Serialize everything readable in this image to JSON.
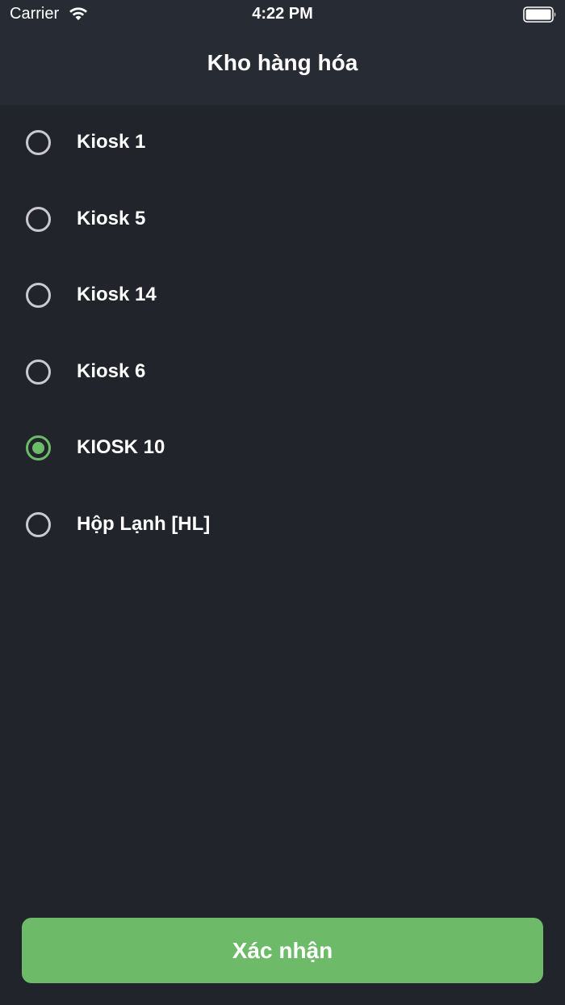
{
  "status_bar": {
    "carrier": "Carrier",
    "time": "4:22 PM",
    "wifi_icon": "wifi-icon",
    "battery_icon": "battery-full-icon"
  },
  "nav": {
    "title": "Kho hàng hóa"
  },
  "options": [
    {
      "label": "Kiosk 1",
      "selected": false
    },
    {
      "label": "Kiosk 5",
      "selected": false
    },
    {
      "label": "Kiosk 14",
      "selected": false
    },
    {
      "label": "Kiosk 6",
      "selected": false
    },
    {
      "label": "KIOSK 10",
      "selected": true
    },
    {
      "label": "Hộp Lạnh [HL]",
      "selected": false
    }
  ],
  "confirm_button": {
    "label": "Xác nhận"
  },
  "colors": {
    "background": "#21252b",
    "header": "#272b33",
    "accent": "#6dbb69",
    "radio_unselected": "#c9c9cf"
  }
}
